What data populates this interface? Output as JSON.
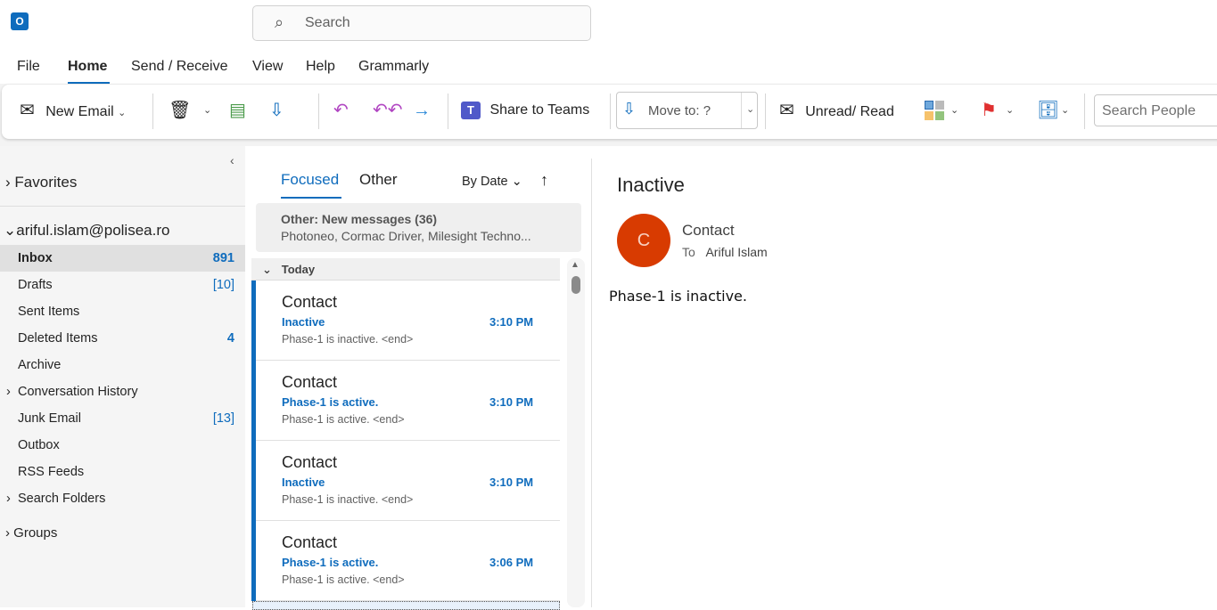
{
  "app": {
    "logo_letter": "O",
    "search_placeholder": "Search"
  },
  "menu": [
    "File",
    "Home",
    "Send / Receive",
    "View",
    "Help",
    "Grammarly"
  ],
  "ribbon": {
    "new_email": "New Email",
    "share_teams": "Share to Teams",
    "move_to": "Move to: ?",
    "unread_read": "Unread/ Read",
    "search_people": "Search People"
  },
  "sidebar": {
    "favorites": "Favorites",
    "account": "ariful.islam@polisea.ro",
    "folders": [
      {
        "label": "Inbox",
        "count": "891"
      },
      {
        "label": "Drafts",
        "count": "[10]"
      },
      {
        "label": "Sent Items",
        "count": ""
      },
      {
        "label": "Deleted Items",
        "count": "4"
      },
      {
        "label": "Archive",
        "count": ""
      },
      {
        "label": "Conversation History",
        "count": ""
      },
      {
        "label": "Junk Email",
        "count": "[13]"
      },
      {
        "label": "Outbox",
        "count": ""
      },
      {
        "label": "RSS Feeds",
        "count": ""
      },
      {
        "label": "Search Folders",
        "count": ""
      }
    ],
    "groups": "Groups"
  },
  "list": {
    "tabs": [
      "Focused",
      "Other"
    ],
    "sort": "By Date",
    "other_banner": {
      "title": "Other: New messages (36)",
      "senders": "Photoneo, Cormac Driver, Milesight Techno..."
    },
    "group_header": "Today",
    "messages": [
      {
        "from": "Contact",
        "subject": "Inactive",
        "time": "3:10 PM",
        "preview": "Phase-1 is inactive. <end>"
      },
      {
        "from": "Contact",
        "subject": "Phase-1 is active.",
        "time": "3:10 PM",
        "preview": "Phase-1 is active. <end>"
      },
      {
        "from": "Contact",
        "subject": "Inactive",
        "time": "3:10 PM",
        "preview": "Phase-1 is inactive. <end>"
      },
      {
        "from": "Contact",
        "subject": "Phase-1 is active.",
        "time": "3:06 PM",
        "preview": "Phase-1 is active. <end>"
      }
    ]
  },
  "reading": {
    "subject": "Inactive",
    "avatar_letter": "C",
    "avatar_color": "#d83b01",
    "sender": "Contact",
    "to_label": "To",
    "to": "Ariful Islam",
    "body": "Phase-1 is inactive."
  }
}
